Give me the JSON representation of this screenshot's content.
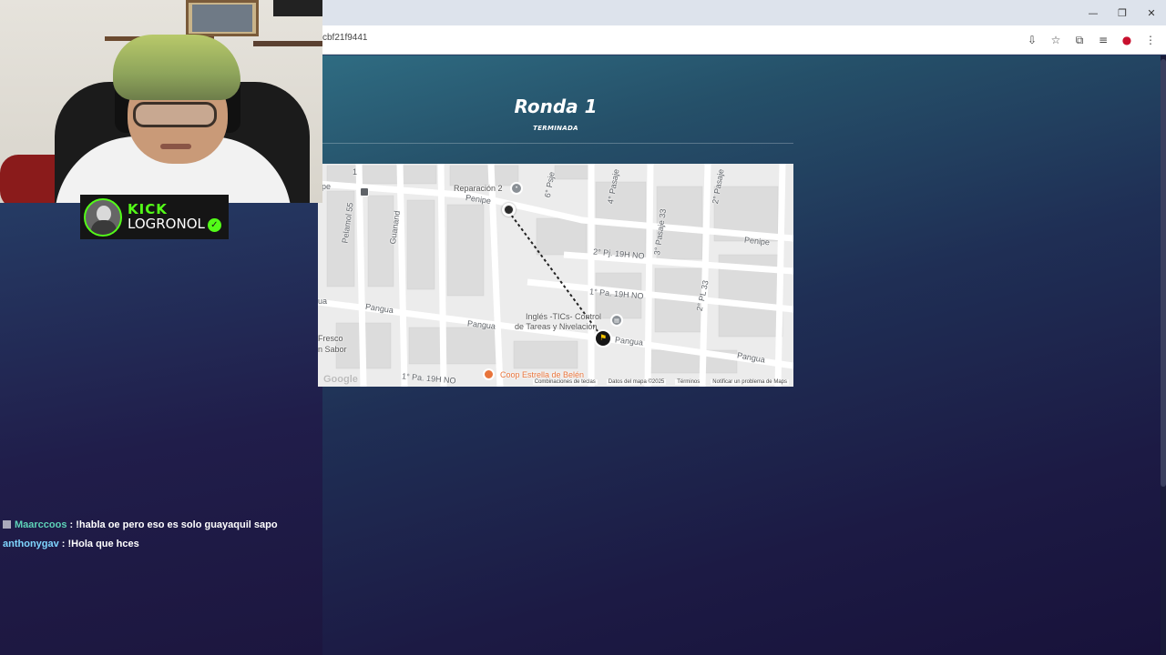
{
  "browser": {
    "address_fragment": "cbf21f9441",
    "window_controls": [
      "minimize",
      "restore",
      "close"
    ],
    "toolbar_icons": [
      "install-icon",
      "star-icon",
      "extensions-icon",
      "media-icon",
      "profile-icon",
      "menu-icon"
    ]
  },
  "game": {
    "round_title": "Ronda 1",
    "round_status": "TERMINADA"
  },
  "map": {
    "streets": {
      "penipe_top": "Penipe",
      "penipe_right": "Penipe",
      "pangua_left": "Pangua",
      "pangua_mid": "Pangua",
      "pangua_target": "Pangua",
      "pangua_right": "Pangua",
      "pasaje_2": "2° Pasaje",
      "psje_6": "6° Psje",
      "pasaje_4": "4° Pasaje",
      "pasaje_33": "3° Pasaje 33",
      "pasaje_2b": "2° Pasaje",
      "guano": "Guanand",
      "pelamol": "Pelamol 55",
      "pj_19": "2° Pj. 19H NO",
      "pa_19": "1° Pa. 19H NO",
      "pa_33": "2° PL 33",
      "pa_19_bottom": "1° Pa. 19H NO",
      "pe_left": "pe",
      "ua_left": "ua",
      "d1": "1"
    },
    "places": {
      "reparacion": "Reparación 2",
      "ingles_1": "Inglés -TICs- Control",
      "ingles_2": "de Tareas y Nivelación",
      "fresco_1": "Fresco",
      "fresco_2": "n Sabor",
      "coop": "Coop Estrella de Belén"
    },
    "footer": {
      "google": "Google",
      "shortcuts": "Combinaciones de teclas",
      "data": "Datos del mapa ©2025",
      "terms": "Términos",
      "report": "Notificar un problema de Maps"
    }
  },
  "stream": {
    "platform": "KICK",
    "username": "LOGRONOL",
    "accent_color": "#53fc18"
  },
  "chat": {
    "messages": [
      {
        "user": "Maarccoos",
        "text": ": !habla oe pero eso es solo guayaquil sapo"
      },
      {
        "user": "anthonygav",
        "text": ": !Hola que hces"
      }
    ]
  }
}
